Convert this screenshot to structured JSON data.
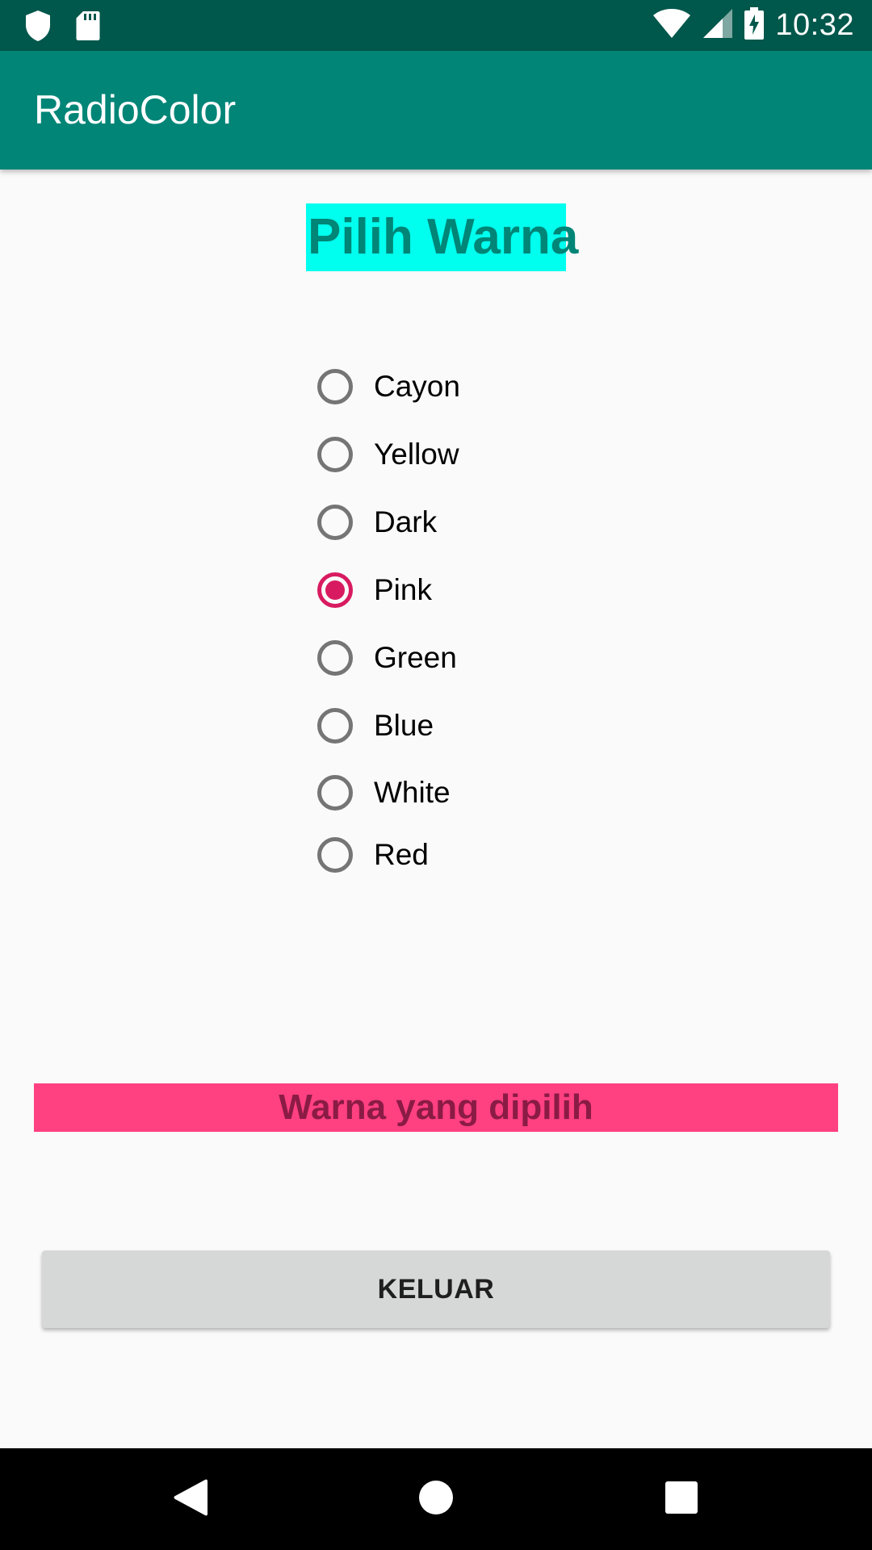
{
  "status_bar": {
    "time": "10:32",
    "icons": [
      "shield-icon",
      "sd-card-icon",
      "wifi-icon",
      "signal-icon",
      "battery-charging-icon"
    ]
  },
  "app_bar": {
    "title": "RadioColor"
  },
  "heading": {
    "text": "Pilih Warna",
    "background": "#00ffee",
    "color": "#008577"
  },
  "radio_group": {
    "options": [
      {
        "label": "Cayon",
        "checked": false
      },
      {
        "label": "Yellow",
        "checked": false
      },
      {
        "label": "Dark",
        "checked": false
      },
      {
        "label": "Pink",
        "checked": true
      },
      {
        "label": "Green",
        "checked": false
      },
      {
        "label": "Blue",
        "checked": false
      },
      {
        "label": "White",
        "checked": false
      },
      {
        "label": "Red",
        "checked": false
      }
    ],
    "accent_color": "#d81b60"
  },
  "result": {
    "text": "Warna yang dipilih",
    "background": "#ff4081"
  },
  "button": {
    "label": "KELUAR"
  },
  "nav_bar": {
    "icons": [
      "back-icon",
      "home-icon",
      "recents-icon"
    ]
  },
  "colors": {
    "status_bar": "#00574b",
    "app_bar": "#008577",
    "background": "#fafafa"
  }
}
